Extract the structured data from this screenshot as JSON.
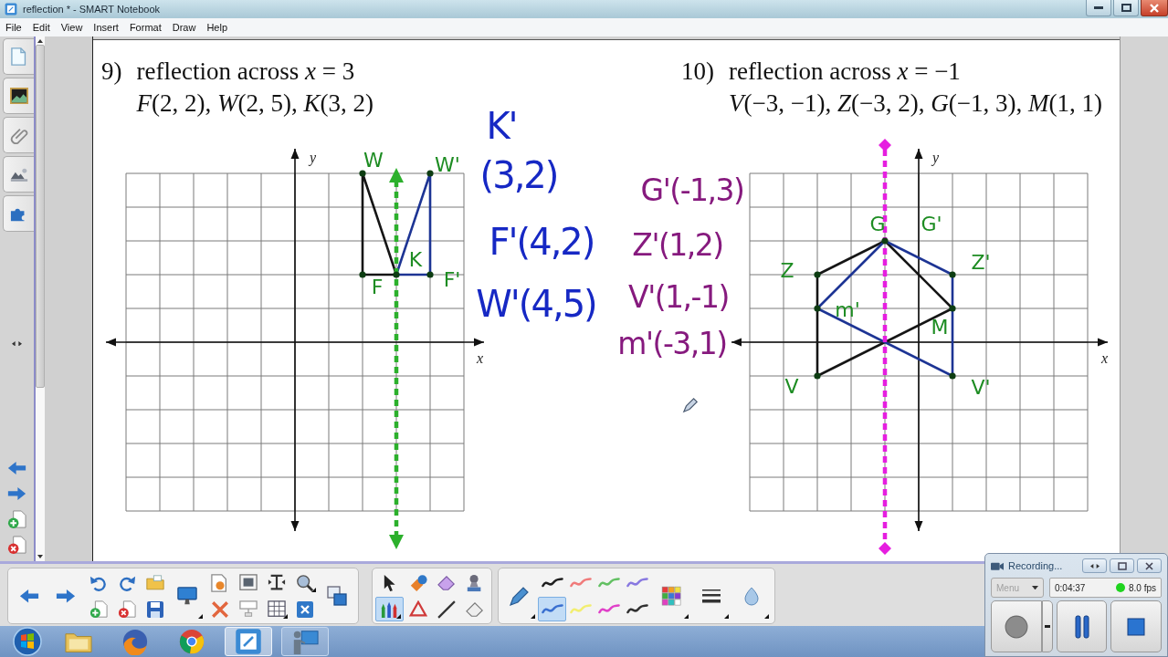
{
  "window": {
    "title": "reflection * - SMART Notebook"
  },
  "menu": [
    "File",
    "Edit",
    "View",
    "Insert",
    "Format",
    "Draw",
    "Help"
  ],
  "problems": [
    {
      "number": "9)",
      "title": "reflection across *x* = 3",
      "points": "*F*(2, 2), *W*(2, 5), *K*(3, 2)",
      "graph": {
        "x_label": "x",
        "y_label": "y",
        "point_labels": [
          "W",
          "W'",
          "F",
          "K",
          "F'"
        ]
      },
      "notes": [
        "K'",
        "(3,2)",
        "F'(4,2)",
        "W'(4,5)"
      ]
    },
    {
      "number": "10)",
      "title": "reflection across *x* = −1",
      "points": "*V*(−3, −1), *Z*(−3, 2), *G*(−1, 3), *M*(1, 1)",
      "graph": {
        "x_label": "x",
        "y_label": "y",
        "point_labels": [
          "G",
          "G'",
          "Z",
          "Z'",
          "m'",
          "M",
          "V",
          "V'"
        ]
      },
      "notes": [
        "G'(-1,3)",
        "Z'(1,2)",
        "V'(1,-1)",
        "m'(-3,1)"
      ]
    }
  ],
  "toolbar": {
    "tools": [
      {
        "selected": false
      },
      {
        "selected": false
      },
      {
        "selected": false
      },
      {
        "selected": false
      },
      {
        "selected": true
      },
      {
        "selected": false
      },
      {
        "selected": false
      },
      {
        "selected": false
      }
    ],
    "pen_styles": [
      {
        "color": "#1e1e1e",
        "selected": false
      },
      {
        "color": "#f07a7a",
        "selected": false
      },
      {
        "color": "#62c062",
        "selected": false
      },
      {
        "color": "#8878e0",
        "selected": false
      },
      {
        "color": "#3a70d0",
        "selected": true
      },
      {
        "color": "#f2ee70",
        "selected": false
      },
      {
        "color": "#e040c8",
        "selected": false
      },
      {
        "color": "#303030",
        "selected": false
      }
    ]
  },
  "recorder": {
    "title": "Recording...",
    "menu": {
      "label": "Menu",
      "disabled": true
    },
    "time": "0:04:37",
    "recording": true,
    "rate": "8.0 fps"
  },
  "taskbar": [
    {
      "running": false,
      "selected": false
    },
    {
      "running": false,
      "selected": false
    },
    {
      "running": false,
      "selected": false
    },
    {
      "running": true,
      "selected": true
    },
    {
      "running": true,
      "selected": false
    }
  ]
}
